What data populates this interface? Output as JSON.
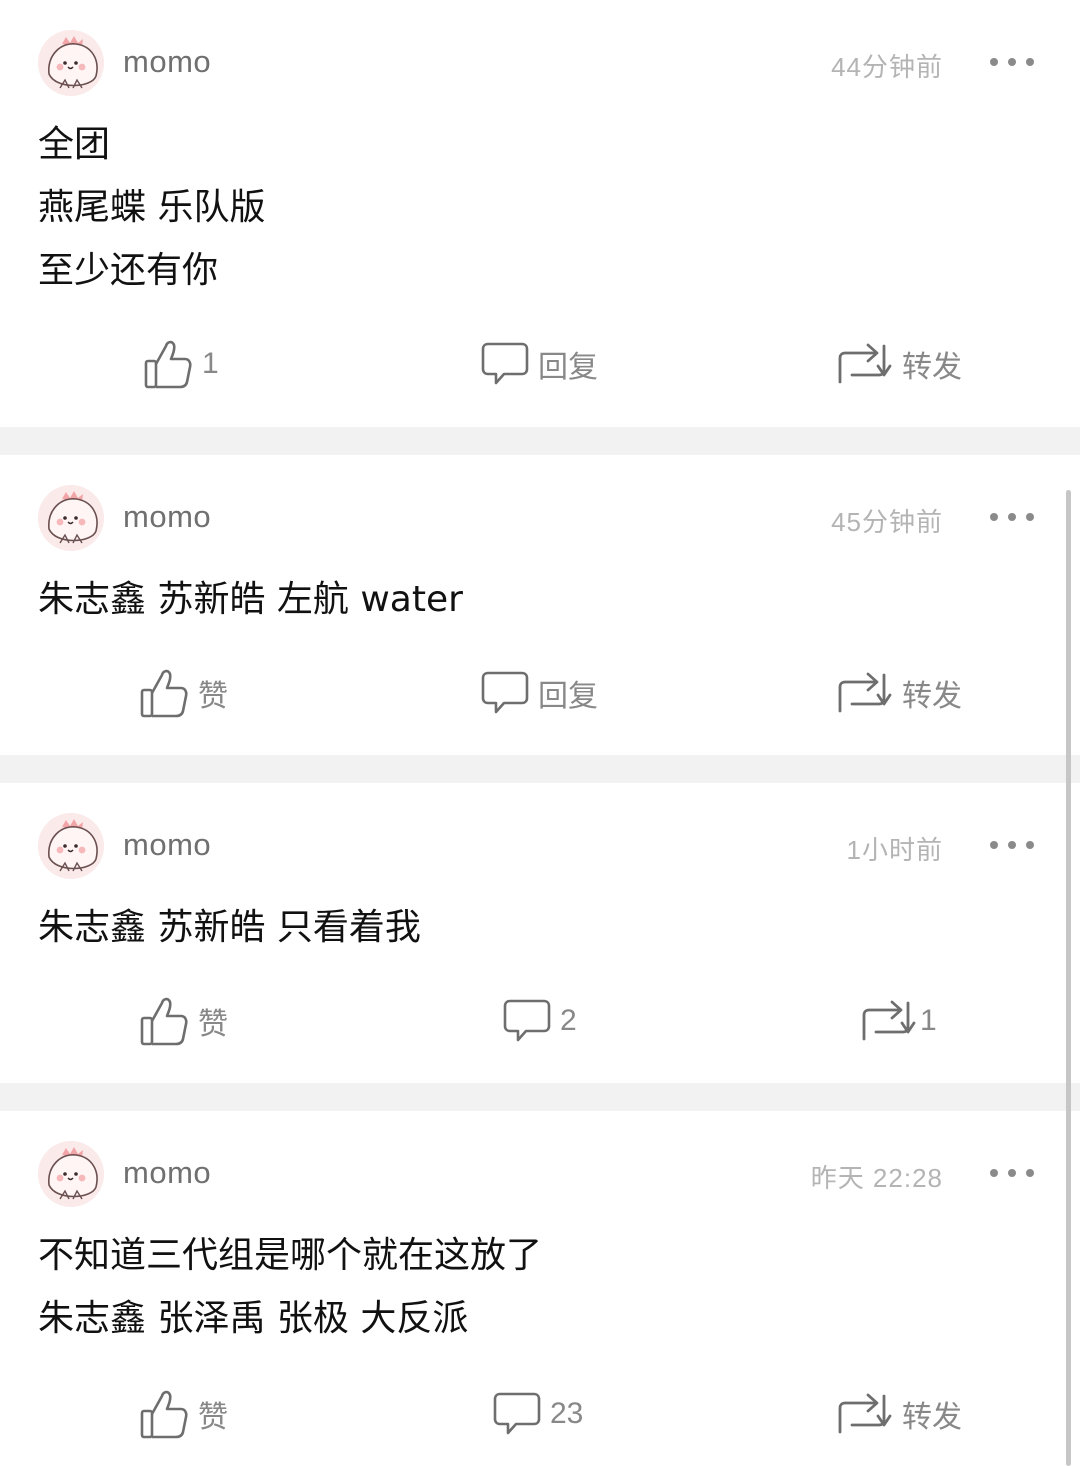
{
  "posts": [
    {
      "username": "momo",
      "time": "44分钟前",
      "lines": [
        "全团",
        "燕尾蝶 乐队版",
        "至少还有你"
      ],
      "like": "1",
      "reply": "回复",
      "share": "转发"
    },
    {
      "username": "momo",
      "time": "45分钟前",
      "lines": [
        "朱志鑫 苏新皓 左航 water"
      ],
      "like": "赞",
      "reply": "回复",
      "share": "转发"
    },
    {
      "username": "momo",
      "time": "1小时前",
      "lines": [
        "朱志鑫 苏新皓 只看着我"
      ],
      "like": "赞",
      "reply": "2",
      "share": "1"
    },
    {
      "username": "momo",
      "time": "昨天 22:28",
      "lines": [
        "不知道三代组是哪个就在这放了",
        "朱志鑫 张泽禹 张极 大反派"
      ],
      "like": "赞",
      "reply": "23",
      "share": "转发"
    }
  ],
  "icons": {
    "like": "thumbs-up-icon",
    "reply": "speech-bubble-icon",
    "share": "repost-icon",
    "more": "more-dots-icon",
    "avatar": "pink-dinosaur-avatar"
  },
  "colors": {
    "background": "#f2f2f2",
    "card": "#ffffff",
    "username": "#707070",
    "time": "#b4b4b4",
    "action_label": "#888888"
  }
}
